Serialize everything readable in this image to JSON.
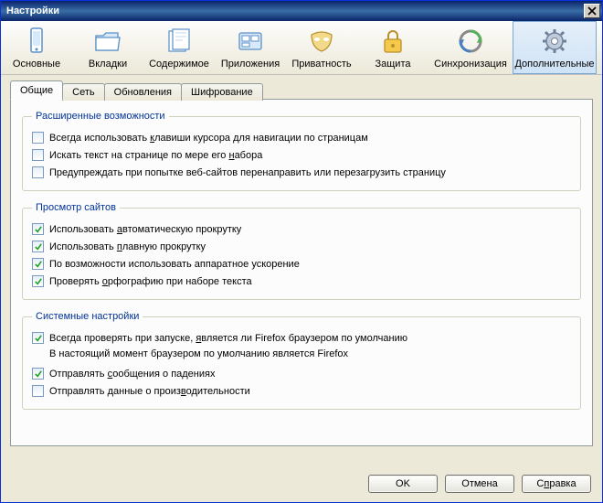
{
  "window": {
    "title": "Настройки"
  },
  "toolbar": {
    "items": [
      {
        "label": "Основные"
      },
      {
        "label": "Вкладки"
      },
      {
        "label": "Содержимое"
      },
      {
        "label": "Приложения"
      },
      {
        "label": "Приватность"
      },
      {
        "label": "Защита"
      },
      {
        "label": "Синхронизация"
      },
      {
        "label": "Дополнительные"
      }
    ]
  },
  "tabs": {
    "general": "Общие",
    "network": "Сеть",
    "updates": "Обновления",
    "encryption": "Шифрование"
  },
  "groups": {
    "advanced": {
      "legend": "Расширенные возможности",
      "cursor_nav": {
        "checked": false,
        "label_pre": "Всегда использовать ",
        "hot": "к",
        "label_post": "лавиши курсора для навигации по страницам"
      },
      "search_as_type": {
        "checked": false,
        "label_pre": "Искать текст на странице по мере его ",
        "hot": "н",
        "label_post": "абора"
      },
      "warn_redirect": {
        "checked": false,
        "label": "Предупреждать при попытке веб-сайтов перенаправить или перезагрузить страницу"
      }
    },
    "browsing": {
      "legend": "Просмотр сайтов",
      "autoscroll": {
        "checked": true,
        "label_pre": "Использовать ",
        "hot": "а",
        "label_post": "втоматическую прокрутку"
      },
      "smoothscroll": {
        "checked": true,
        "label_pre": "Использовать ",
        "hot": "п",
        "label_post": "лавную прокрутку"
      },
      "hwaccel": {
        "checked": true,
        "label": "По возможности использовать аппаратное ускорение"
      },
      "spellcheck": {
        "checked": true,
        "label_pre": "Проверять ",
        "hot": "о",
        "label_post": "рфографию при наборе текста"
      }
    },
    "system": {
      "legend": "Системные настройки",
      "default_check": {
        "checked": true,
        "label_pre": "Всегда проверять при запуске, ",
        "hot": "я",
        "label_post": "вляется ли Firefox браузером по умолчанию"
      },
      "status": "В настоящий момент браузером по умолчанию является Firefox",
      "crash": {
        "checked": true,
        "label_pre": "Отправлять ",
        "hot": "с",
        "label_post": "ообщения о падениях"
      },
      "perf": {
        "checked": false,
        "label_pre": "Отправлять данные о произ",
        "hot": "в",
        "label_post": "одительности"
      }
    }
  },
  "buttons": {
    "ok": "OK",
    "cancel": "Отмена",
    "help_pre": "С",
    "help_hot": "п",
    "help_post": "равка"
  }
}
